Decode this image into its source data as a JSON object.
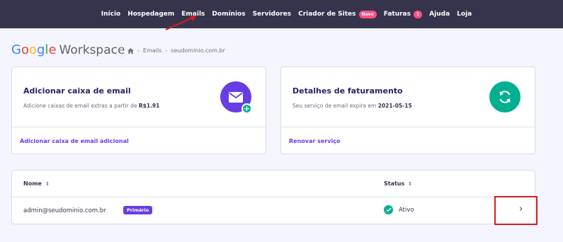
{
  "nav": {
    "items": [
      {
        "label": "Início"
      },
      {
        "label": "Hospedagem"
      },
      {
        "label": "Emails"
      },
      {
        "label": "Domínios"
      },
      {
        "label": "Servidores"
      },
      {
        "label": "Criador de Sites",
        "badge": "Novo"
      },
      {
        "label": "Faturas",
        "badge": "1"
      },
      {
        "label": "Ajuda"
      },
      {
        "label": "Loja"
      }
    ]
  },
  "header": {
    "brand_google": [
      "G",
      "o",
      "o",
      "g",
      "l",
      "e"
    ],
    "brand_product": "Workspace",
    "breadcrumb": {
      "home_icon": "home-icon",
      "sep1": "-",
      "item1": "Emails",
      "sep2": "-",
      "item2": "seudominio.com.br"
    }
  },
  "cards": {
    "add_mailbox": {
      "title": "Adicionar caixa de email",
      "subtitle": "Adicione caixas de email extras a partir de",
      "price": "R$1.91",
      "link": "Adicionar caixa de email adicional",
      "icon": "mail-icon"
    },
    "billing": {
      "title": "Detalhes de faturamento",
      "subtitle": "Seu serviço de email expira em",
      "expiry": "2021-05-15",
      "link": "Renovar serviço",
      "icon": "refresh-icon"
    }
  },
  "table": {
    "headers": {
      "name": "Nome",
      "status": "Status",
      "sort_icon": "⇕"
    },
    "rows": [
      {
        "email": "admin@seudominio.com.br",
        "badge": "Primário",
        "status": "Ativo"
      }
    ],
    "chevron": "›"
  },
  "colors": {
    "nav_bg": "#36344d",
    "accent": "#673de6",
    "success": "#00b090",
    "badge": "#fc5185",
    "annotation": "#d51c1c"
  }
}
